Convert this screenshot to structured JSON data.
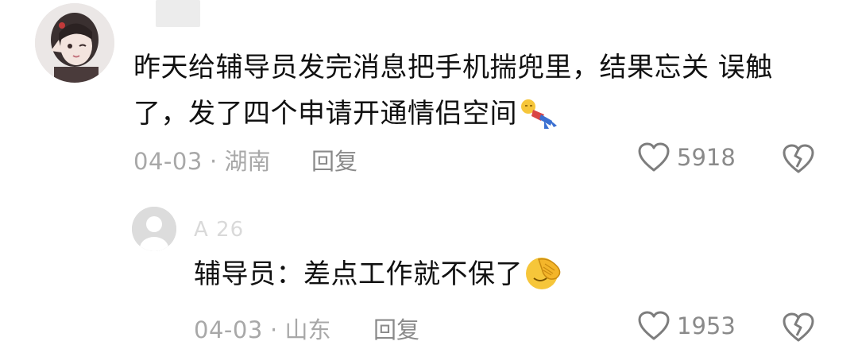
{
  "comment": {
    "text": "昨天给辅导员发完消息把手机揣兜里，结果忘关 误触了，发了四个申请开通情侣空间",
    "date": "04-03",
    "location": "湖南",
    "reply_label": "回复",
    "likes": "5918"
  },
  "reply": {
    "username": "A     26",
    "text": "辅导员：差点工作就不保了",
    "date": "04-03",
    "location": "山东",
    "reply_label": "回复",
    "likes": "1953"
  },
  "icons": {
    "like": "heart-outline-icon",
    "dislike": "broken-heart-icon",
    "emoji_main": "falling-person-emoji",
    "emoji_reply": "facepalm-emoji"
  },
  "colors": {
    "text": "#111111",
    "meta": "#a8a8a8",
    "icon": "#8a8a8a"
  }
}
